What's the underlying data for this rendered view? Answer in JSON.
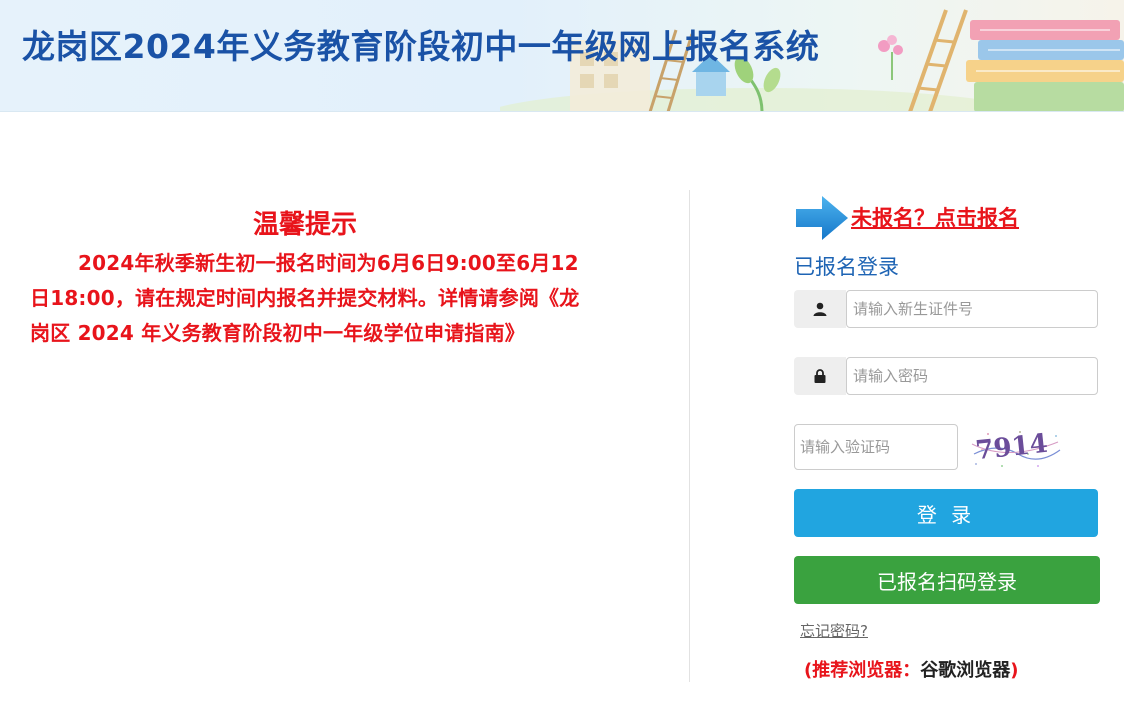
{
  "header": {
    "title": "龙岗区2024年义务教育阶段初中一年级网上报名系统"
  },
  "notice": {
    "title": "温馨提示",
    "body": "2024年秋季新生初一报名时间为6月6日9:00至6月12日18:00，请在规定时间内报名并提交材料。详情请参阅《龙岗区 2024 年义务教育阶段初中一年级学位申请指南》"
  },
  "login": {
    "register_link": "未报名？点击报名",
    "heading": "已报名登录",
    "id_placeholder": "请输入新生证件号",
    "password_placeholder": "请输入密码",
    "captcha_placeholder": "请输入验证码",
    "captcha_text": "7914",
    "login_button": "登 录",
    "scan_login_button": "已报名扫码登录",
    "forgot_password": "忘记密码?",
    "browser_tip_prefix": "(推荐浏览器：",
    "browser_tip_name": "谷歌浏览器",
    "browser_tip_suffix": ")"
  },
  "icons": {
    "user": "user-icon",
    "lock": "lock-icon",
    "arrow": "arrow-right-icon"
  },
  "colors": {
    "header_title": "#1a52a6",
    "notice_red": "#e8141b",
    "login_blue": "#21a5e0",
    "scan_green": "#3aa23f",
    "heading_blue": "#1e64b4"
  }
}
